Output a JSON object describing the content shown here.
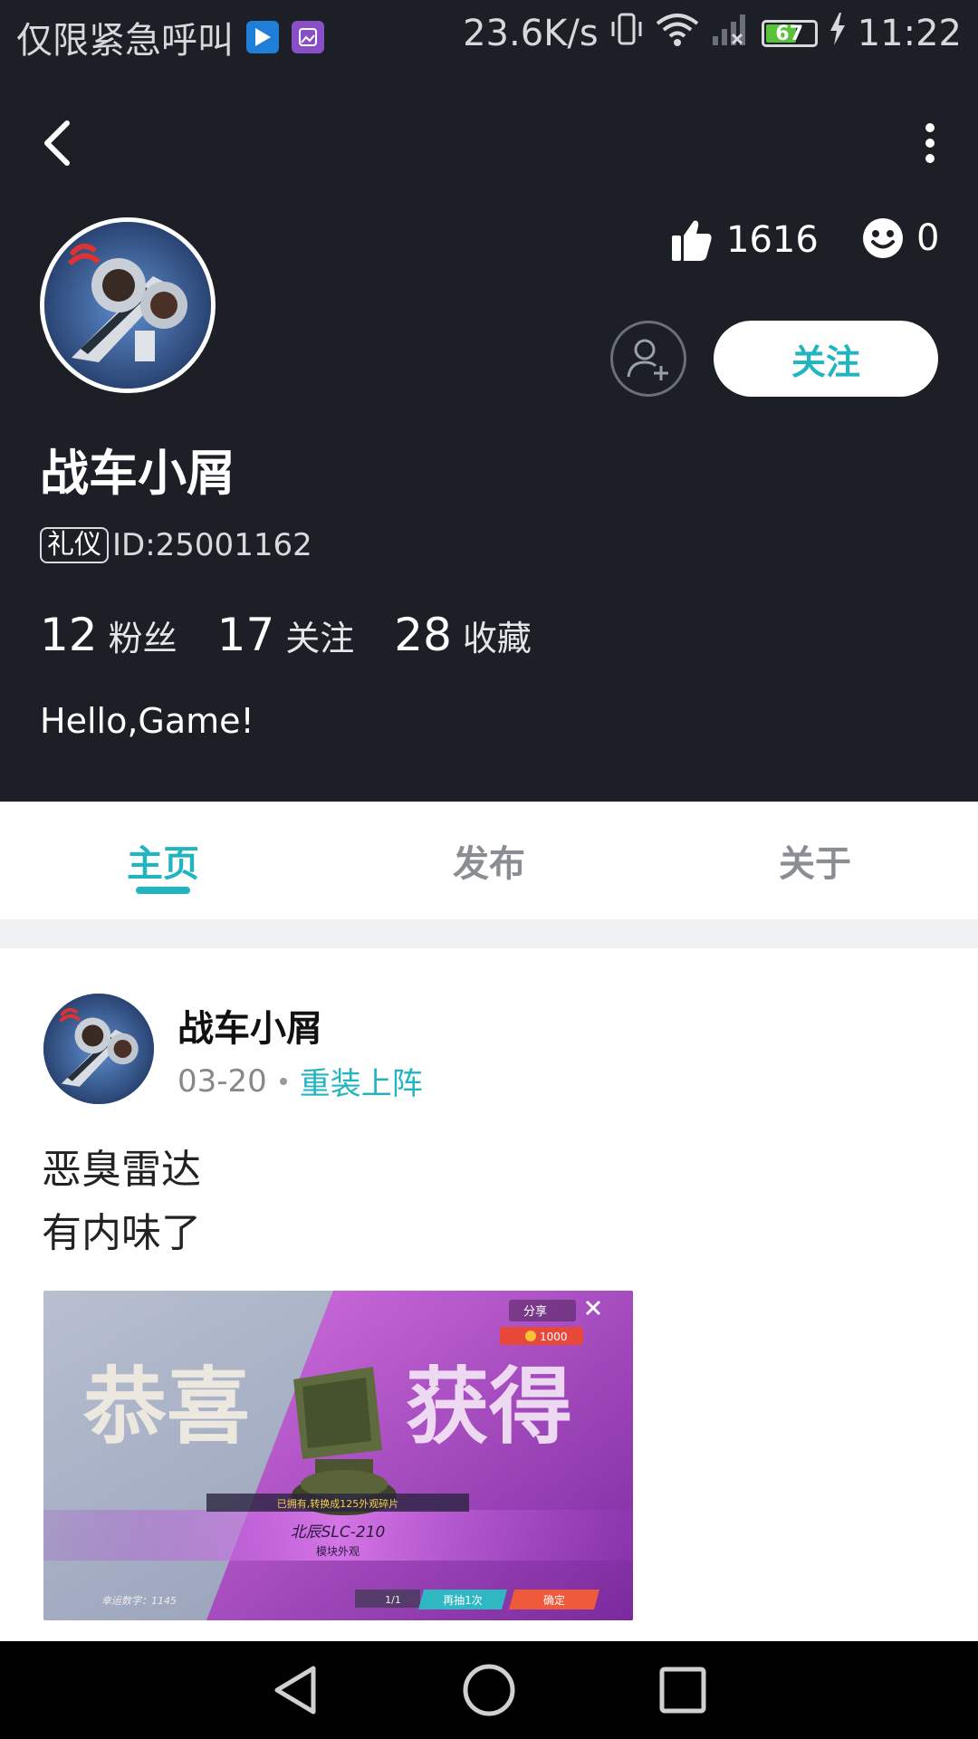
{
  "status_bar": {
    "carrier_text": "仅限紧急呼叫",
    "net_speed": "23.6K/s",
    "battery": "67",
    "battery_level": 0.67,
    "time": "11:22"
  },
  "profile": {
    "likes": "1616",
    "mood_count": "0",
    "follow_label": "关注",
    "username": "战车小屑",
    "badge": "礼仪",
    "user_id": "ID:25001162",
    "fans_count": "12",
    "fans_label": "粉丝",
    "following_count": "17",
    "following_label": "关注",
    "favorites_count": "28",
    "favorites_label": "收藏",
    "bio": "Hello,Game!"
  },
  "tabs": [
    {
      "label": "主页",
      "active": true
    },
    {
      "label": "发布",
      "active": false
    },
    {
      "label": "关于",
      "active": false
    }
  ],
  "post": {
    "author": "战车小屑",
    "date": "03-20",
    "game": "重装上阵",
    "lines": [
      "恶臭雷达",
      "有内味了"
    ],
    "image": {
      "share": "分享",
      "coins": "1000",
      "banner_left": "恭喜",
      "banner_right": "获得",
      "owned_note": "已拥有,转换成125外观碎片",
      "item_name": "北辰SLC-210",
      "item_type": "模块外观",
      "lucky_number": "幸运数字：1145",
      "counter": "1/1",
      "retry": "再抽1次",
      "confirm": "确定"
    }
  },
  "colors": {
    "header_bg": "#1c1f26",
    "accent": "#22b5c0"
  }
}
